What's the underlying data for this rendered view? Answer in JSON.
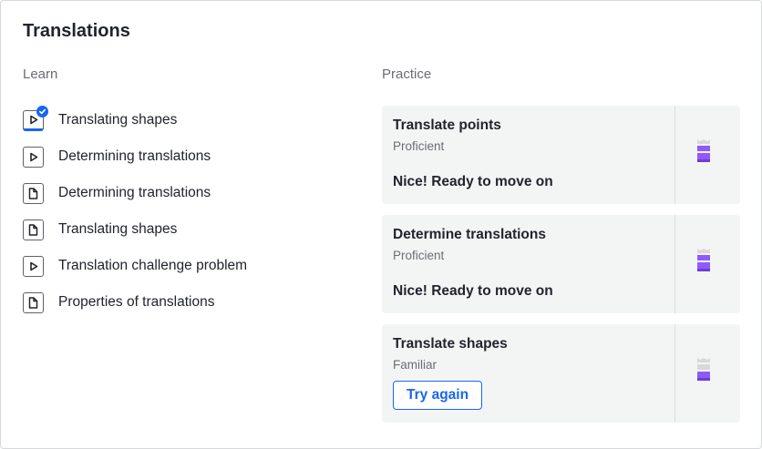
{
  "header": {
    "title": "Translations"
  },
  "learn": {
    "label": "Learn",
    "items": [
      {
        "label": "Translating shapes",
        "icon": "video-icon",
        "completed": true
      },
      {
        "label": "Determining translations",
        "icon": "video-icon",
        "completed": false
      },
      {
        "label": "Determining translations",
        "icon": "article-icon",
        "completed": false
      },
      {
        "label": "Translating shapes",
        "icon": "article-icon",
        "completed": false
      },
      {
        "label": "Translation challenge problem",
        "icon": "video-icon",
        "completed": false
      },
      {
        "label": "Properties of translations",
        "icon": "article-icon",
        "completed": false
      }
    ]
  },
  "practice": {
    "label": "Practice",
    "items": [
      {
        "title": "Translate points",
        "level": "Proficient",
        "message": "Nice! Ready to move on",
        "mastery_level": 3
      },
      {
        "title": "Determine translations",
        "level": "Proficient",
        "message": "Nice! Ready to move on",
        "mastery_level": 3
      },
      {
        "title": "Translate shapes",
        "level": "Familiar",
        "button": "Try again",
        "mastery_level": 2
      }
    ]
  },
  "colors": {
    "accent": "#1865f2",
    "mastery_purple": "#9059ff",
    "mastery_empty": "#d8d8d8",
    "card_bg": "#f3f5f5"
  }
}
